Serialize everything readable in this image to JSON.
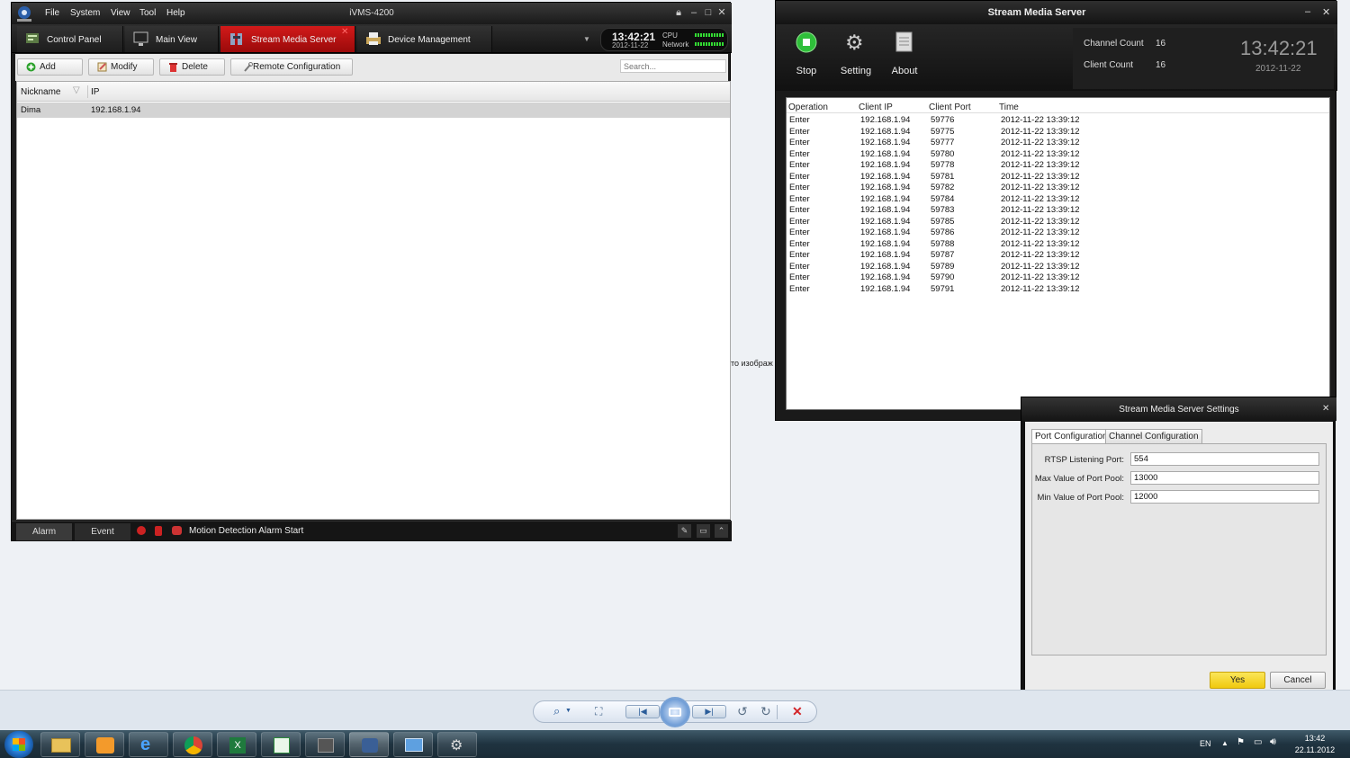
{
  "ivms": {
    "menu": [
      "File",
      "System",
      "View",
      "Tool",
      "Help"
    ],
    "title": "iVMS-4200",
    "tabs": [
      {
        "label": "Control Panel",
        "icon": "control-panel-icon"
      },
      {
        "label": "Main View",
        "icon": "monitor-icon"
      },
      {
        "label": "Stream Media Server",
        "icon": "stream-server-icon"
      },
      {
        "label": "Device Management",
        "icon": "printer-device-icon"
      }
    ],
    "clock": {
      "time": "13:42:21",
      "date": "2012-11-22",
      "cpu_label": "CPU",
      "network_label": "Network"
    },
    "toolbar": {
      "add": "Add",
      "modify": "Modify",
      "delete": "Delete",
      "remote_config": "Remote Configuration",
      "search_placeholder": "Search..."
    },
    "table": {
      "headers": [
        "Nickname",
        "IP"
      ],
      "rows": [
        {
          "nickname": "Dima",
          "ip": "192.168.1.94"
        }
      ]
    },
    "statusbar": {
      "alarm": "Alarm",
      "event": "Event",
      "message": "Motion Detection Alarm Start"
    }
  },
  "sms": {
    "title": "Stream Media Server",
    "tools": {
      "stop": "Stop",
      "setting": "Setting",
      "about": "About"
    },
    "counts": {
      "channel_label": "Channel Count",
      "channel_value": "16",
      "client_label": "Client Count",
      "client_value": "16",
      "time": "13:42:21",
      "date": "2012-11-22"
    },
    "log": {
      "headers": [
        "Operation",
        "Client IP",
        "Client Port",
        "Time"
      ],
      "operation": "Enter\nEnter\nEnter\nEnter\nEnter\nEnter\nEnter\nEnter\nEnter\nEnter\nEnter\nEnter\nEnter\nEnter\nEnter\nEnter",
      "client_ip": "192.168.1.94\n192.168.1.94\n192.168.1.94\n192.168.1.94\n192.168.1.94\n192.168.1.94\n192.168.1.94\n192.168.1.94\n192.168.1.94\n192.168.1.94\n192.168.1.94\n192.168.1.94\n192.168.1.94\n192.168.1.94\n192.168.1.94\n192.168.1.94",
      "client_port": "59776\n59775\n59777\n59780\n59778\n59781\n59782\n59784\n59783\n59785\n59786\n59788\n59787\n59789\n59790\n59791",
      "time": "2012-11-22 13:39:12\n2012-11-22 13:39:12\n2012-11-22 13:39:12\n2012-11-22 13:39:12\n2012-11-22 13:39:12\n2012-11-22 13:39:12\n2012-11-22 13:39:12\n2012-11-22 13:39:12\n2012-11-22 13:39:12\n2012-11-22 13:39:12\n2012-11-22 13:39:12\n2012-11-22 13:39:12\n2012-11-22 13:39:12\n2012-11-22 13:39:12\n2012-11-22 13:39:12\n2012-11-22 13:39:12"
    }
  },
  "dialog": {
    "title": "Stream Media Server Settings",
    "tabs": [
      "Port Configuration",
      "Channel Configuration"
    ],
    "fields": [
      {
        "label": "RTSP Listening Port:",
        "value": "554"
      },
      {
        "label": "Max Value of Port Pool:",
        "value": "13000"
      },
      {
        "label": "Min Value of Port Pool:",
        "value": "12000"
      }
    ],
    "yes": "Yes",
    "cancel": "Cancel"
  },
  "desktop": {
    "side_fragment": "то изображ"
  },
  "taskbar": {
    "lang": "EN",
    "time": "13:42",
    "date": "22.11.2012"
  },
  "colors": {
    "active_tab": "#c41414",
    "yes_button": "#f5d21c",
    "stop_green": "#2fbf3a"
  }
}
